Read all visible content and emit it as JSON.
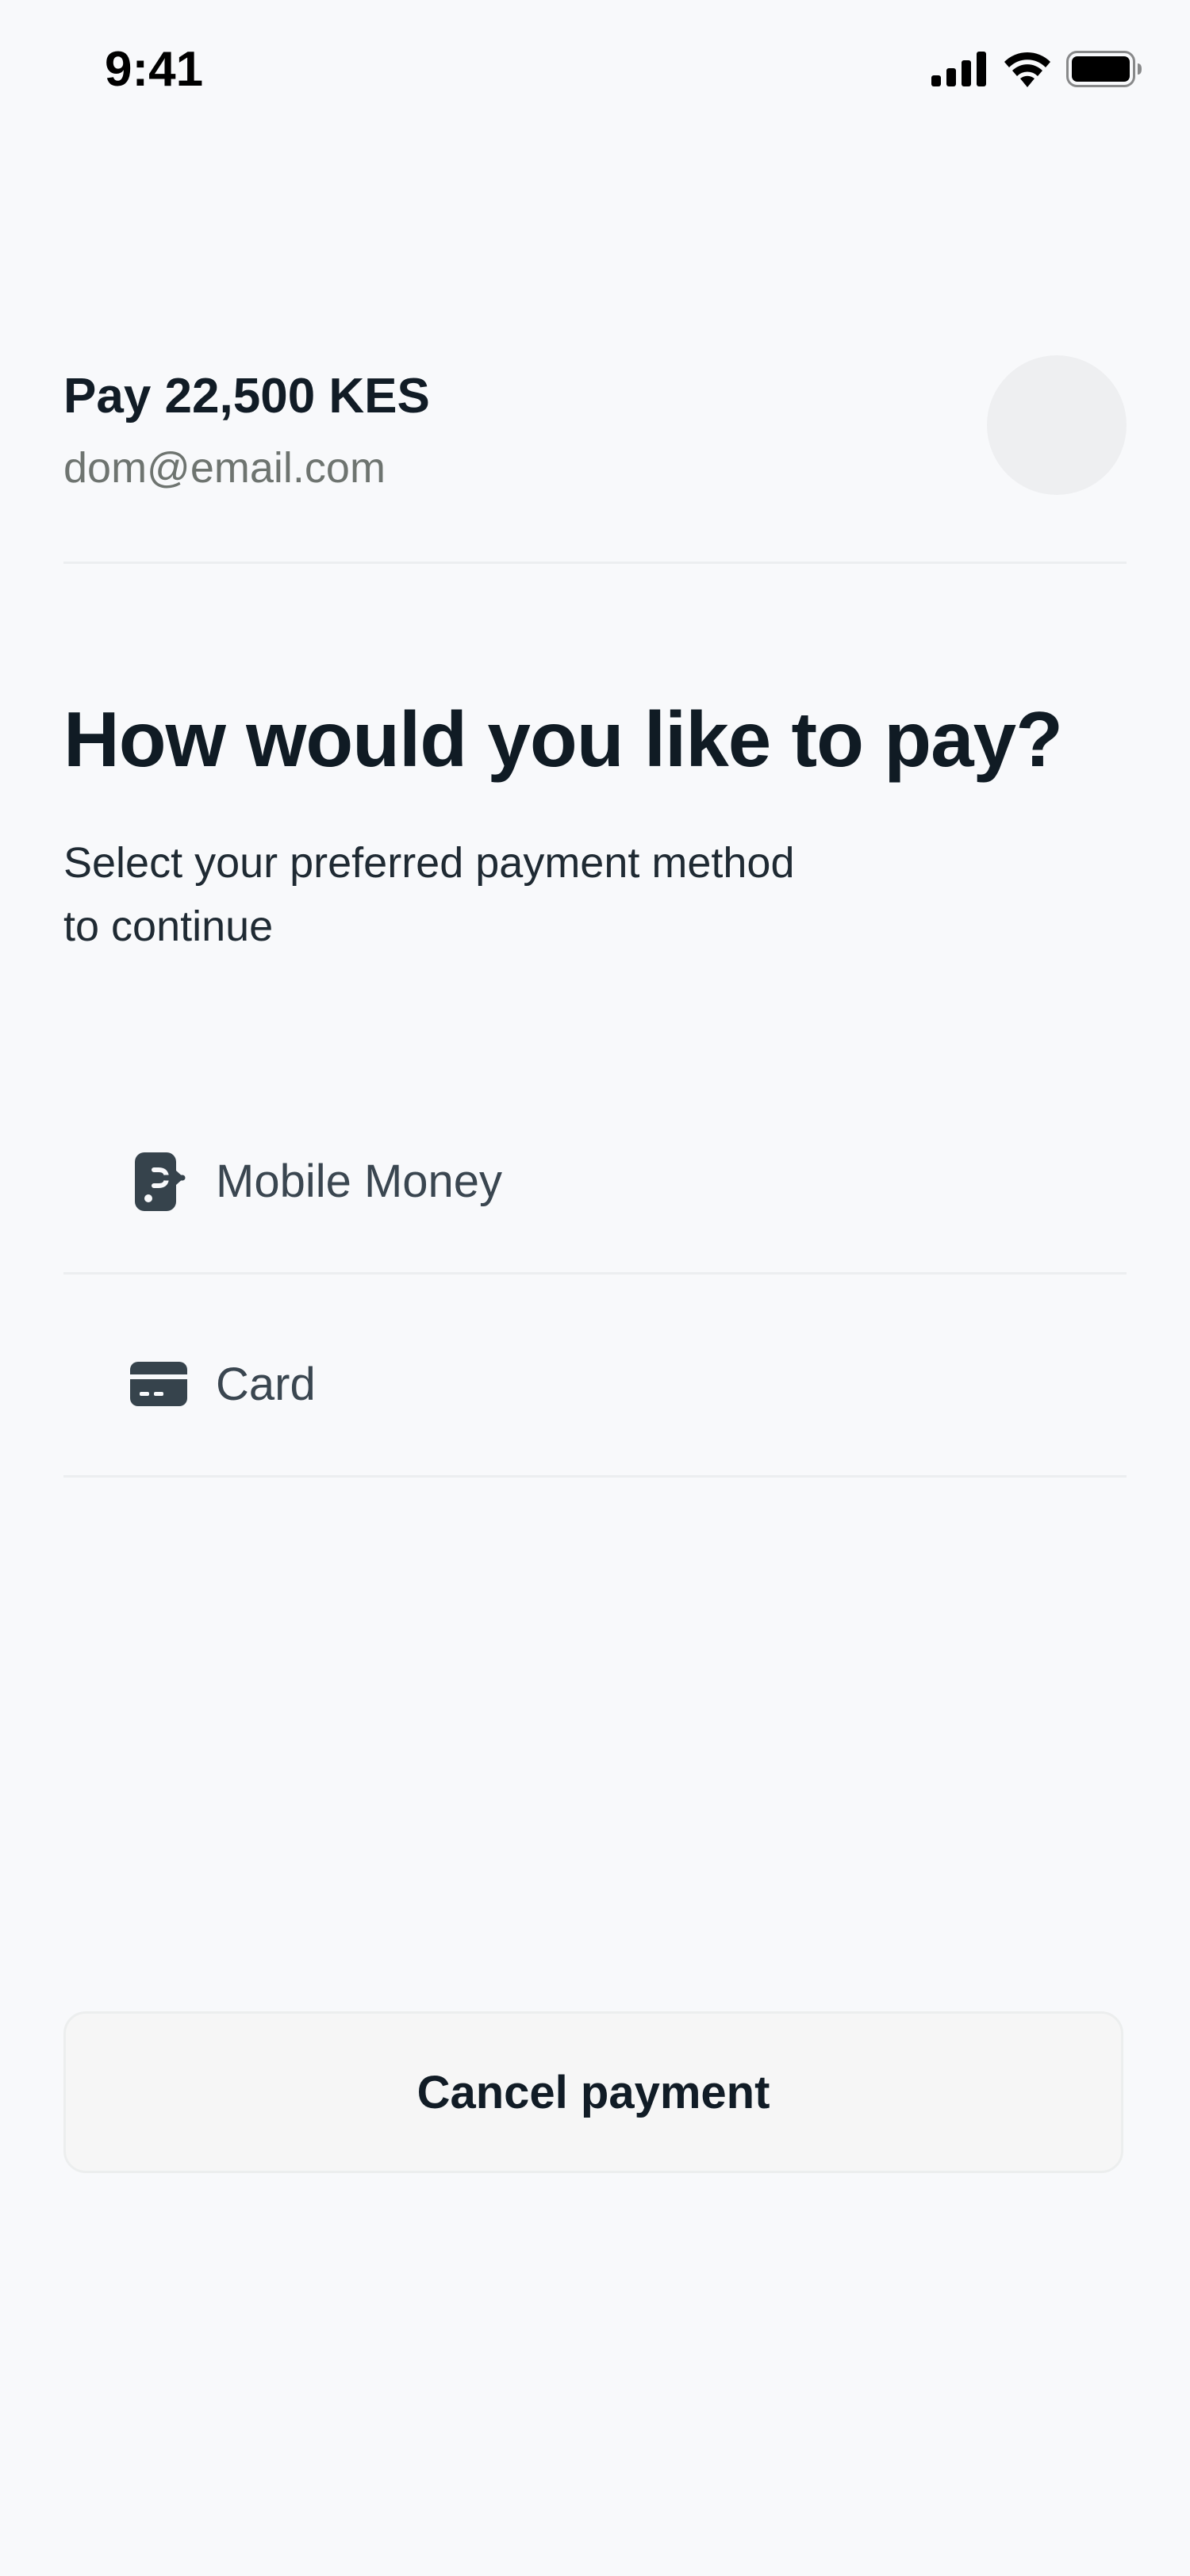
{
  "status_bar": {
    "time": "9:41"
  },
  "header": {
    "pay_title": "Pay 22,500 KES",
    "email": "dom@email.com"
  },
  "main": {
    "question": "How would you like to pay?",
    "subtitle_line1": "Select your preferred payment method",
    "subtitle_line2": "to continue"
  },
  "payment_methods": [
    {
      "label": "Mobile Money",
      "icon": "mobile-money-icon"
    },
    {
      "label": "Card",
      "icon": "card-icon"
    }
  ],
  "footer": {
    "cancel_label": "Cancel payment"
  },
  "colors": {
    "background": "#f8f9fb",
    "text_primary": "#101b24",
    "text_secondary": "#6e7470",
    "icon": "#36434c",
    "divider": "#eceef0",
    "button_bg": "#f6f6f6"
  }
}
